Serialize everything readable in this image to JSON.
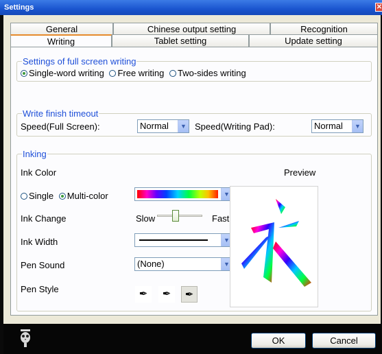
{
  "window": {
    "title": "Settings",
    "close_glyph": "✕"
  },
  "tabs": {
    "row1": [
      "General",
      "Chinese output setting",
      "Recognition"
    ],
    "row2": [
      "Writing",
      "Tablet setting",
      "Update setting"
    ],
    "selected": "Writing"
  },
  "fullscreen": {
    "title": "Settings of full screen writing",
    "options": [
      "Single-word writing",
      "Free writing",
      "Two-sides writing"
    ],
    "selected": "Single-word writing"
  },
  "timeout": {
    "title": "Write finish timeout",
    "speed_full_label": "Speed(Full Screen):",
    "speed_full_value": "Normal",
    "speed_pad_label": "Speed(Writing Pad):",
    "speed_pad_value": "Normal"
  },
  "inking": {
    "title": "Inking",
    "ink_color_label": "Ink Color",
    "preview_label": "Preview",
    "single_label": "Single",
    "multi_label": "Multi-color",
    "color_mode": "Multi-color",
    "ink_change_label": "Ink Change",
    "slow_label": "Slow",
    "fast_label": "Fast",
    "ink_change_level": 0.4,
    "ink_width_label": "Ink Width",
    "pen_sound_label": "Pen Sound",
    "pen_sound_value": "(None)",
    "pen_style_label": "Pen Style",
    "preview_char": "永"
  },
  "buttons": {
    "ok": "OK",
    "cancel": "Cancel"
  },
  "icons": {
    "app": "owl-icon",
    "dropdown": "chevron-down-icon",
    "pen": "pen-style-icon"
  },
  "colors": {
    "accent": "#1e4fd8",
    "selected_tab": "#e68b2c",
    "titlebar": "#1a55cf"
  }
}
